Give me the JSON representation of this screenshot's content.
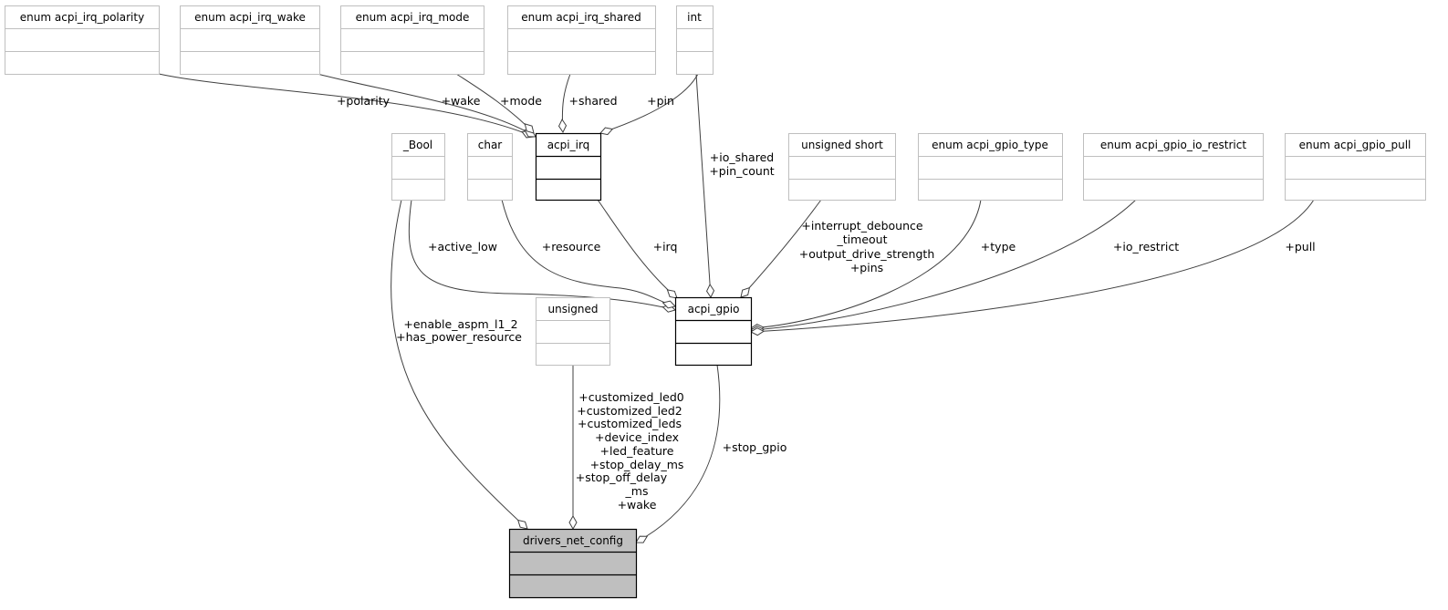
{
  "nodes": {
    "irq_polarity": "enum acpi_irq_polarity",
    "irq_wake": "enum acpi_irq_wake",
    "irq_mode": "enum acpi_irq_mode",
    "irq_shared": "enum acpi_irq_shared",
    "int": "int",
    "acpi_irq": "acpi_irq",
    "bool": "_Bool",
    "char": "char",
    "unsigned_short": "unsigned short",
    "gpio_type": "enum acpi_gpio_type",
    "gpio_io_restrict": "enum acpi_gpio_io_restrict",
    "gpio_pull": "enum acpi_gpio_pull",
    "unsigned": "unsigned",
    "acpi_gpio": "acpi_gpio",
    "drivers_net_config": "drivers_net_config"
  },
  "edges": {
    "polarity": "+polarity",
    "wake": "+wake",
    "mode": "+mode",
    "shared": "+shared",
    "pin": "+pin",
    "io_shared": [
      "+io_shared",
      "+pin_count"
    ],
    "irq": "+irq",
    "active_low": "+active_low",
    "resource": "+resource",
    "debounce": [
      "+interrupt_debounce",
      "_timeout",
      "+output_drive_strength",
      "+pins"
    ],
    "type": "+type",
    "io_restrict": "+io_restrict",
    "pull": "+pull",
    "bool_fields": [
      "+enable_aspm_l1_2",
      "+has_power_resource"
    ],
    "unsigned_fields": [
      "+customized_led0",
      "+customized_led2",
      "+customized_leds",
      "+device_index",
      "+led_feature",
      "+stop_delay_ms",
      "+stop_off_delay",
      "_ms",
      "+wake"
    ],
    "stop_gpio": "+stop_gpio"
  },
  "colors": {
    "focus_node": "#bfbfbf",
    "external_border": "#bfbfbf",
    "edge": "#404040"
  }
}
